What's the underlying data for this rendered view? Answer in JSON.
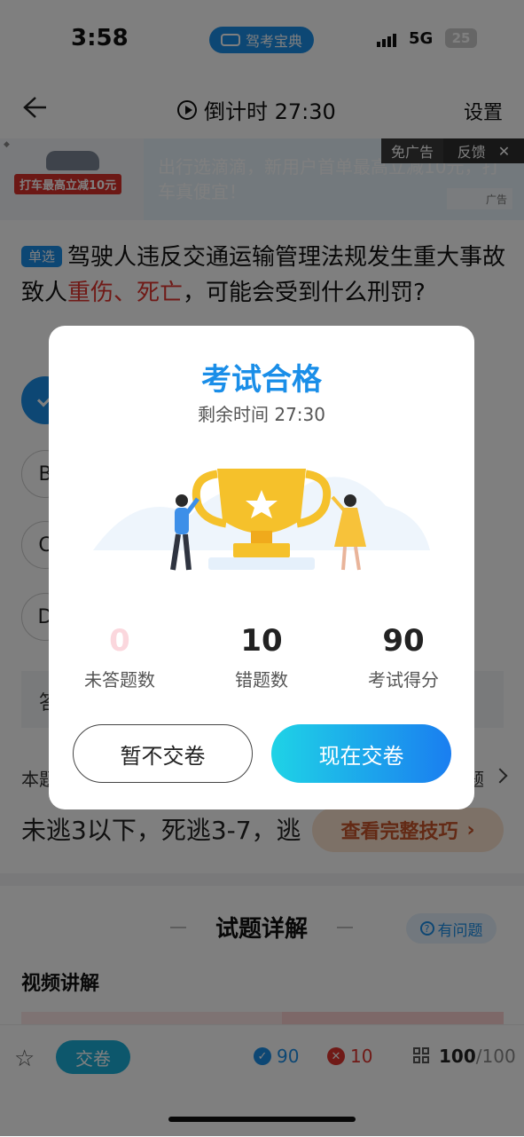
{
  "status_bar": {
    "time": "3:58",
    "app": "驾考宝典",
    "network": "5G",
    "battery": "25"
  },
  "nav": {
    "timer_label": "倒计时 27:30",
    "settings": "设置"
  },
  "ad": {
    "text": "出行选滴滴，新用户首单最高立减10元，打车真便宜！",
    "promo": "打车最高立减10元",
    "free_label": "免广告",
    "feedback_label": "反馈",
    "close_label": "✕",
    "ad_tag": "广告"
  },
  "question": {
    "type_tag": "单选",
    "text_before": "驾驶人违反交通运输管理法规发生重大事故致人",
    "text_highlight": "重伤、死亡",
    "text_after": "，可能会受到什么刑罚?"
  },
  "options": [
    "B",
    "C",
    "D"
  ],
  "answer_bar_partial": "答",
  "tip": {
    "label_partial": "本题",
    "right_partial": "题",
    "text": "未逃3以下，死逃3-7，逃",
    "full_tip_button": "查看完整技巧"
  },
  "detail": {
    "title": "试题详解",
    "ask": "有问题",
    "video": "视频讲解"
  },
  "bottom_bar": {
    "submit": "交卷",
    "correct_count": "90",
    "wrong_count": "10",
    "progress_done": "100",
    "progress_total": "/100"
  },
  "modal": {
    "title": "考试合格",
    "remaining": "剩余时间 27:30",
    "stats": [
      {
        "value": "0",
        "label": "未答题数"
      },
      {
        "value": "10",
        "label": "错题数"
      },
      {
        "value": "90",
        "label": "考试得分"
      }
    ],
    "later_button": "暂不交卷",
    "submit_button": "现在交卷"
  },
  "colors": {
    "accent": "#1a8ee8",
    "error": "#e0352e",
    "gold": "#f5c12b"
  }
}
